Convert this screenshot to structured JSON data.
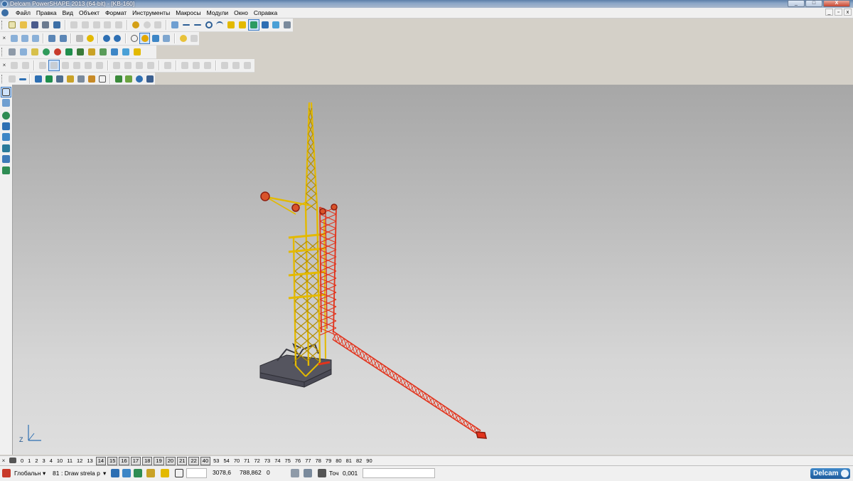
{
  "window": {
    "title": "Delcam PowerSHAPE 2013 (64-bit) - [KB-160]",
    "buttons": [
      "_",
      "□",
      "X"
    ]
  },
  "menu": {
    "items": [
      "Файл",
      "Правка",
      "Вид",
      "Объект",
      "Формат",
      "Инструменты",
      "Макросы",
      "Модули",
      "Окно",
      "Справка"
    ],
    "mdi_buttons": [
      "_",
      "▫",
      "x"
    ]
  },
  "colors": {
    "tower": "#e3b900",
    "tower_dark": "#b58f00",
    "boom": "#e2331c",
    "base": "#4a4a55",
    "accent": "#3a78c0"
  },
  "toolbars": {
    "row1_icons": [
      "new-icon",
      "open-icon",
      "save-icon",
      "print-icon",
      "cut-icon",
      "copy-icon",
      "paste-icon",
      "delete-icon",
      "undo-icon",
      "redo-icon",
      "line-icon",
      "arc-icon",
      "circle-icon",
      "curve-icon",
      "text-icon",
      "shading-icon"
    ],
    "row2_icons": [
      "select-icon",
      "sheet-icon",
      "cube-icon",
      "sphere-icon",
      "cone-icon",
      "cylinder-icon",
      "torus-icon",
      "extrude-icon"
    ],
    "row3_icons": [
      "solid-icon",
      "solid-box-icon",
      "solid-sphere-icon",
      "solid-feature-icon",
      "blend-icon"
    ],
    "row4_icons": [
      "surface-icon",
      "wireframe-icon",
      "mesh-icon",
      "assembly-icon",
      "component-icon"
    ]
  },
  "levels": {
    "items": [
      "0",
      "1",
      "2",
      "3",
      "4",
      "10",
      "11",
      "12",
      "13",
      "14",
      "15",
      "16",
      "17",
      "18",
      "19",
      "20",
      "21",
      "22",
      "40",
      "53",
      "54",
      "70",
      "71",
      "72",
      "73",
      "74",
      "75",
      "76",
      "77",
      "78",
      "79",
      "80",
      "81",
      "82",
      "90"
    ],
    "boxed": [
      "14",
      "15",
      "16",
      "17",
      "18",
      "19",
      "20",
      "21",
      "22",
      "40"
    ]
  },
  "status": {
    "workplane": "Глобальн",
    "level": "81",
    "level_name": ": Draw strela p",
    "x": "3078,6",
    "y": "788,862",
    "z": "0",
    "tolerance_label": "Точ",
    "tolerance": "0,001",
    "brand": "Delcam"
  },
  "axes": {
    "z_label": "Z"
  }
}
